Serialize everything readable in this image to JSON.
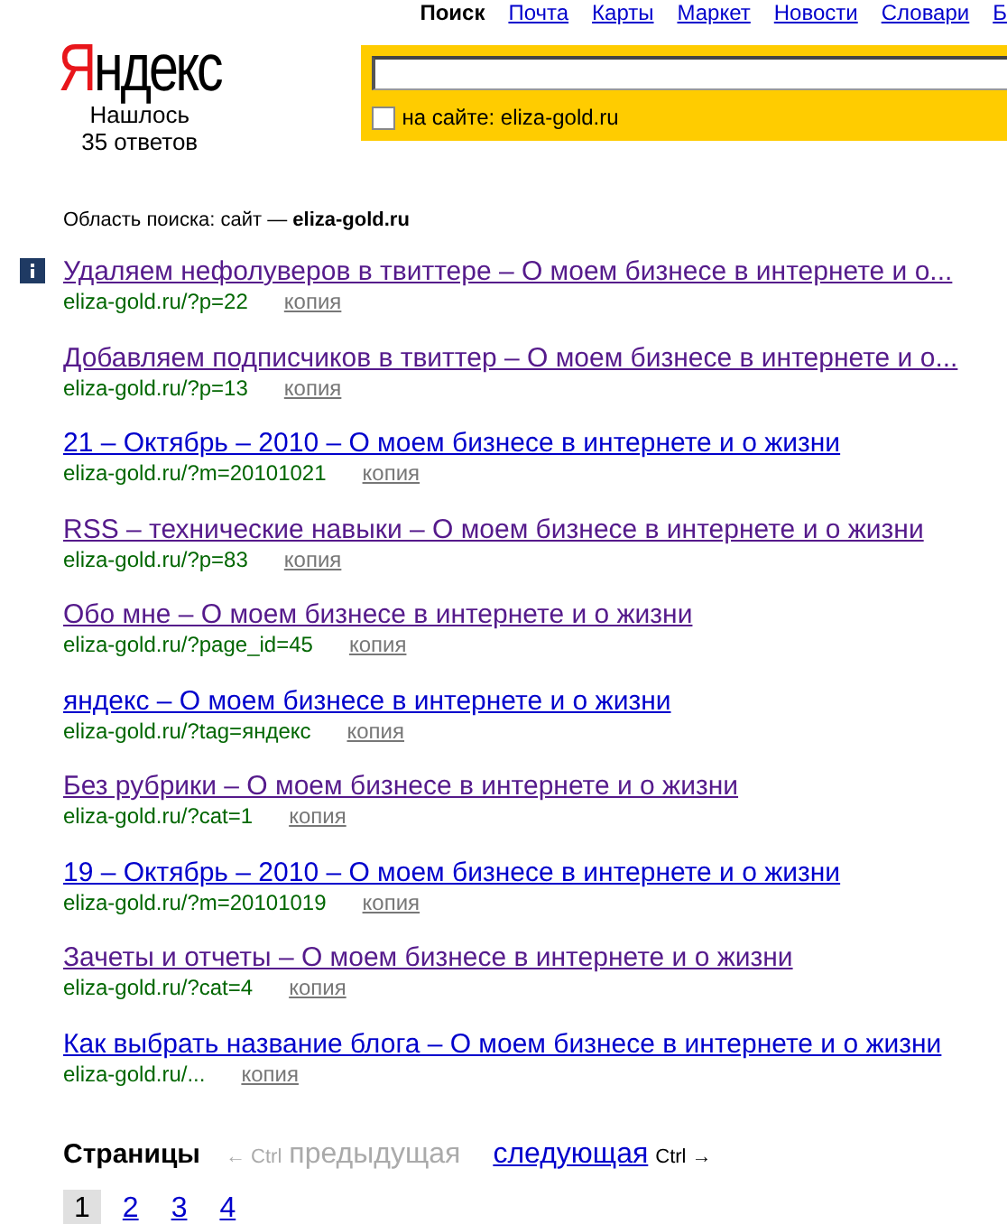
{
  "nav": [
    {
      "label": "Поиск",
      "selected": true
    },
    {
      "label": "Почта",
      "selected": false
    },
    {
      "label": "Карты",
      "selected": false
    },
    {
      "label": "Маркет",
      "selected": false
    },
    {
      "label": "Новости",
      "selected": false
    },
    {
      "label": "Словари",
      "selected": false
    },
    {
      "label": "Б",
      "selected": false
    }
  ],
  "logo": {
    "first": "Я",
    "rest": "ндекс"
  },
  "found": [
    "Нашлось",
    "35 ответов"
  ],
  "search": {
    "site_checkbox": {
      "label": "на сайте: eliza-gold.ru",
      "checked": false
    }
  },
  "scope": {
    "label": "Область поиска: сайт —",
    "site": "eliza-gold.ru"
  },
  "results": [
    {
      "title": "Удаляем нефолуверов в твиттере – О моем бизнесе в интернете и о...",
      "url": "eliza-gold.ru/?p=22",
      "copy": "копия",
      "visited": true,
      "info": true
    },
    {
      "title": "Добавляем подписчиков в твиттер – О моем бизнесе в интернете и о...",
      "url": "eliza-gold.ru/?p=13",
      "copy": "копия",
      "visited": true,
      "info": false
    },
    {
      "title": "21 – Октябрь – 2010 – О моем бизнесе в интернете и о жизни",
      "url": "eliza-gold.ru/?m=20101021",
      "copy": "копия",
      "visited": false,
      "info": false
    },
    {
      "title": "RSS – технические навыки – О моем бизнесе в интернете и о жизни",
      "url": "eliza-gold.ru/?p=83",
      "copy": "копия",
      "visited": true,
      "info": false
    },
    {
      "title": "Обо мне – О моем бизнесе в интернете и о жизни",
      "url": "eliza-gold.ru/?page_id=45",
      "copy": "копия",
      "visited": true,
      "info": false
    },
    {
      "title": "яндекс – О моем бизнесе в интернете и о жизни",
      "url": "eliza-gold.ru/?tag=яндекс",
      "copy": "копия",
      "visited": false,
      "info": false
    },
    {
      "title": "Без рубрики – О моем бизнесе в интернете и о жизни",
      "url": "eliza-gold.ru/?cat=1",
      "copy": "копия",
      "visited": true,
      "info": false
    },
    {
      "title": "19 – Октябрь – 2010 – О моем бизнесе в интернете и о жизни",
      "url": "eliza-gold.ru/?m=20101019",
      "copy": "копия",
      "visited": false,
      "info": false
    },
    {
      "title": "Зачеты и отчеты – О моем бизнесе в интернете и о жизни",
      "url": "eliza-gold.ru/?cat=4",
      "copy": "копия",
      "visited": true,
      "info": false
    },
    {
      "title": "Как выбрать название блога – О моем бизнесе в интернете и о жизни",
      "url": "eliza-gold.ru/...",
      "copy": "копия",
      "visited": false,
      "info": false
    }
  ],
  "pagination": {
    "label": "Страницы",
    "prev": {
      "hint": "← Ctrl",
      "label": "предыдущая",
      "disabled": true
    },
    "next": {
      "label": "следующая",
      "hint": "Ctrl →",
      "disabled": false
    },
    "pages": [
      {
        "label": "1",
        "selected": true
      },
      {
        "label": "2",
        "selected": false
      },
      {
        "label": "3",
        "selected": false
      },
      {
        "label": "4",
        "selected": false
      }
    ]
  }
}
